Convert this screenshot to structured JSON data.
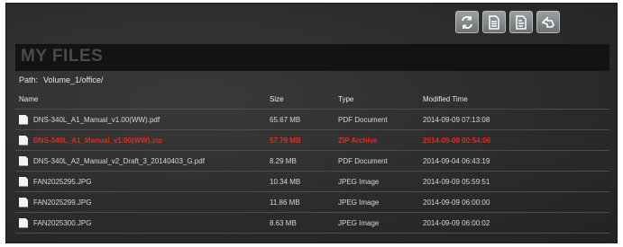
{
  "toolbar": {
    "buttons": [
      {
        "icon": "refresh-icon"
      },
      {
        "icon": "document-list-icon"
      },
      {
        "icon": "document-icon"
      },
      {
        "icon": "arrow-back-icon"
      }
    ]
  },
  "header": {
    "title": "MY FILES"
  },
  "path": {
    "label": "Path:",
    "value": "Volume_1/office/"
  },
  "table": {
    "columns": [
      "Name",
      "Size",
      "Type",
      "Modified Time"
    ],
    "rows": [
      {
        "name": "DNS-340L_A1_Manual_v1.00(WW).pdf",
        "size": "65.67 MB",
        "type": "PDF Document",
        "modified": "2014-09-09 07:13:08",
        "selected": false
      },
      {
        "name": "DNS-340L_A1_Manual_v1.00(WW).zip",
        "size": "57.79 MB",
        "type": "ZIP Archive",
        "modified": "2014-09-09 00:54:06",
        "selected": true
      },
      {
        "name": "DNS-340L_A2_Manual_v2_Draft_3_20140403_G.pdf",
        "size": "8.29 MB",
        "type": "PDF Document",
        "modified": "2014-09-04 06:43:19",
        "selected": false
      },
      {
        "name": "FAN2025295.JPG",
        "size": "10.34 MB",
        "type": "JPEG Image",
        "modified": "2014-09-09 05:59:51",
        "selected": false
      },
      {
        "name": "FAN2025299.JPG",
        "size": "11.86 MB",
        "type": "JPEG Image",
        "modified": "2014-09-09 06:00:00",
        "selected": false
      },
      {
        "name": "FAN2025300.JPG",
        "size": "8.63 MB",
        "type": "JPEG Image",
        "modified": "2014-09-09 06:00:02",
        "selected": false
      }
    ]
  },
  "colors": {
    "selected_text": "#e52a1f",
    "panel_bg": "#2b2b2b",
    "header_bar": "#131313"
  }
}
